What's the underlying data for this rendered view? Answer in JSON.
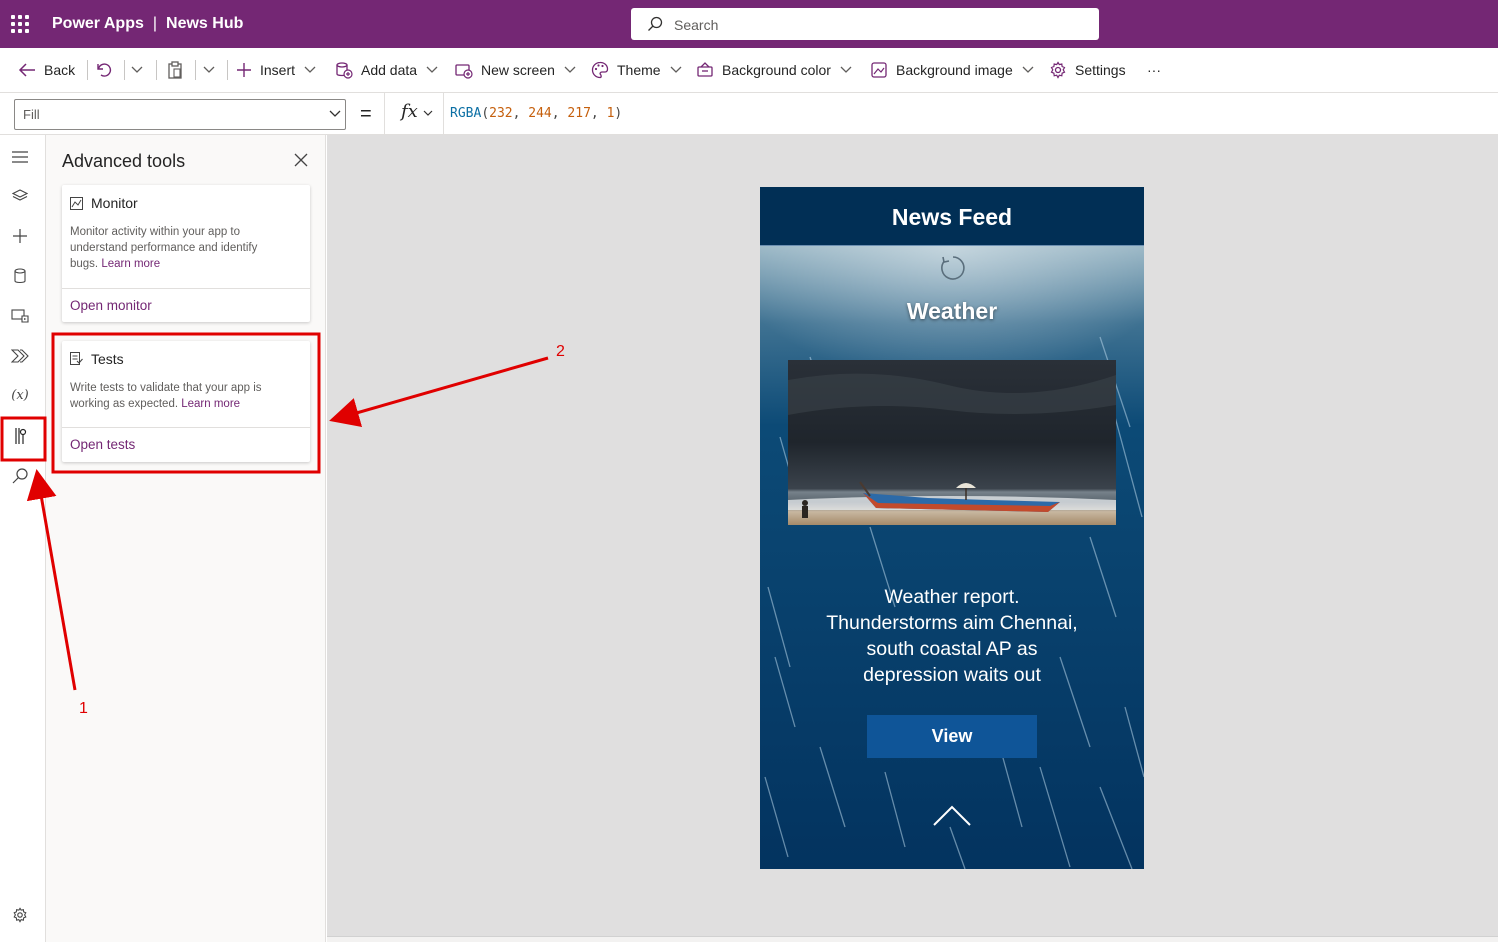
{
  "header": {
    "product": "Power Apps",
    "separator": "|",
    "app_name": "News Hub",
    "search_placeholder": "Search"
  },
  "toolbar": {
    "back": "Back",
    "insert": "Insert",
    "add_data": "Add data",
    "new_screen": "New screen",
    "theme": "Theme",
    "background_color": "Background color",
    "background_image": "Background image",
    "settings": "Settings",
    "more": "···"
  },
  "formula_bar": {
    "property": "Fill",
    "equals": "=",
    "fx": "fx",
    "formula": {
      "fn": "RGBA",
      "open": "(",
      "r": "232",
      "g": "244",
      "b": "217",
      "a": "1",
      "comma": ", ",
      "close": ")"
    }
  },
  "panel": {
    "title": "Advanced tools",
    "cards": [
      {
        "name": "Monitor",
        "description": "Monitor activity within your app to understand performance and identify bugs.",
        "learn_more": "Learn more",
        "action": "Open monitor"
      },
      {
        "name": "Tests",
        "description": "Write tests to validate that your app is working as expected.",
        "learn_more": "Learn more",
        "action": "Open tests"
      }
    ]
  },
  "screen": {
    "header_title": "News Feed",
    "section_title": "Weather",
    "article_text": "Weather report. Thunderstorms aim Chennai, south coastal AP as depression waits out",
    "view_button": "View"
  },
  "annotations": {
    "label_1": "1",
    "label_2": "2",
    "color": "#e00000"
  },
  "colors": {
    "brand": "#742774",
    "screen_header": "#012f55",
    "screen_bg": "#043a6b",
    "view_button": "#0f5598"
  }
}
